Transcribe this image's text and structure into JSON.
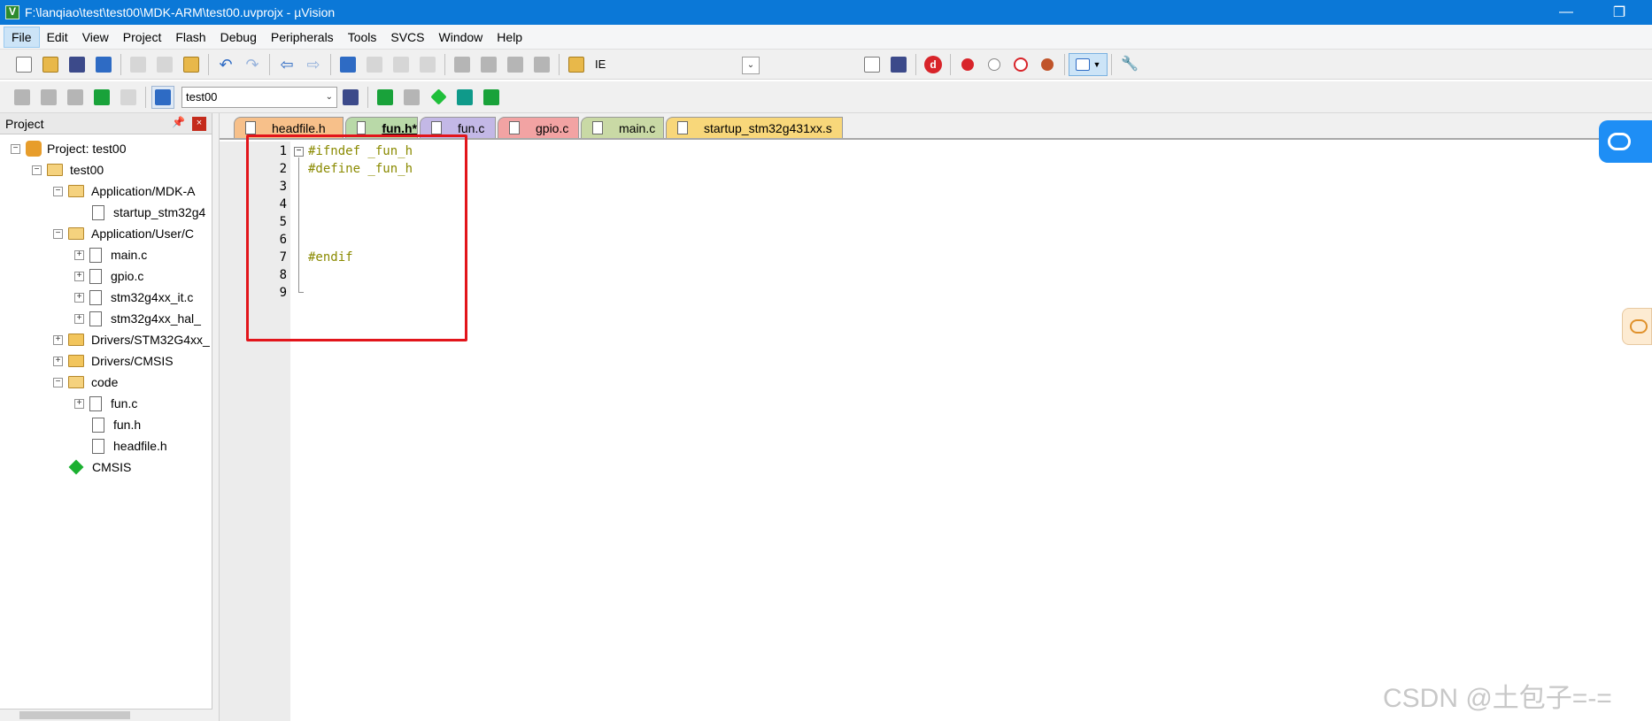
{
  "window": {
    "title": "F:\\lanqiao\\test\\test00\\MDK-ARM\\test00.uvprojx - µVision",
    "minimize_glyph": "—",
    "restore_glyph": "❐"
  },
  "menu": [
    {
      "label": "File",
      "active": true
    },
    {
      "label": "Edit"
    },
    {
      "label": "View"
    },
    {
      "label": "Project"
    },
    {
      "label": "Flash"
    },
    {
      "label": "Debug"
    },
    {
      "label": "Peripherals"
    },
    {
      "label": "Tools"
    },
    {
      "label": "SVCS"
    },
    {
      "label": "Window"
    },
    {
      "label": "Help"
    }
  ],
  "toolbar1": {
    "find_text": "IE"
  },
  "toolbar2": {
    "target": "test00"
  },
  "project_panel": {
    "title": "Project",
    "pin_glyph": "📌",
    "close_glyph": "×",
    "tree": [
      {
        "label": "Project: test00"
      },
      {
        "label": "test00"
      },
      {
        "label": "Application/MDK-A"
      },
      {
        "label": "startup_stm32g4"
      },
      {
        "label": "Application/User/C"
      },
      {
        "label": "main.c"
      },
      {
        "label": "gpio.c"
      },
      {
        "label": "stm32g4xx_it.c"
      },
      {
        "label": "stm32g4xx_hal_"
      },
      {
        "label": "Drivers/STM32G4xx_"
      },
      {
        "label": "Drivers/CMSIS"
      },
      {
        "label": "code"
      },
      {
        "label": "fun.c"
      },
      {
        "label": "fun.h"
      },
      {
        "label": "headfile.h"
      },
      {
        "label": "CMSIS"
      }
    ]
  },
  "tabs": [
    {
      "label": "headfile.h",
      "color": "#f7c08a"
    },
    {
      "label": "fun.h*",
      "color": "#b9d9a8",
      "active": true
    },
    {
      "label": "fun.c",
      "color": "#c3b8e6"
    },
    {
      "label": "gpio.c",
      "color": "#f2a3a3"
    },
    {
      "label": "main.c",
      "color": "#c9d9a5"
    },
    {
      "label": "startup_stm32g431xx.s",
      "color": "#f8d77a"
    }
  ],
  "editor": {
    "lines": [
      {
        "no": "1",
        "text": "#ifndef _fun_h"
      },
      {
        "no": "2",
        "text": "#define _fun_h"
      },
      {
        "no": "3",
        "text": ""
      },
      {
        "no": "4",
        "text": ""
      },
      {
        "no": "5",
        "text": ""
      },
      {
        "no": "6",
        "text": ""
      },
      {
        "no": "7",
        "text": "#endif"
      },
      {
        "no": "8",
        "text": ""
      },
      {
        "no": "9",
        "text": ""
      }
    ]
  },
  "watermark": "CSDN @土包子=-="
}
